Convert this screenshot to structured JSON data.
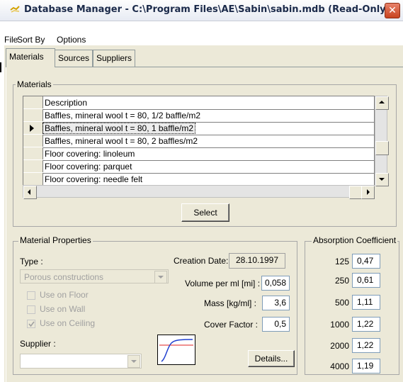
{
  "window": {
    "title": "Database Manager - C:\\Program Files\\AE\\Sabin\\sabin.mdb (Read-Only)",
    "close_label": "✕"
  },
  "menu": [
    {
      "label": "File"
    },
    {
      "label": "Sort By"
    },
    {
      "label": "Options"
    }
  ],
  "tabs": [
    {
      "label": "Materials",
      "active": true
    },
    {
      "label": "Sources",
      "active": false
    },
    {
      "label": "Suppliers",
      "active": false
    }
  ],
  "materials_group": {
    "label": "Materials",
    "column_header": "Description",
    "rows": [
      "Baffles, mineral wool  t = 80,  1/2 baffle/m2",
      "Baffles, mineral wool  t = 80,  1 baffle/m2",
      "Baffles, mineral wool  t = 80,  2 baffles/m2",
      "Floor covering: linoleum",
      "Floor covering: parquet",
      "Floor covering: needle felt"
    ],
    "selected_row_index": 1,
    "select_button": "Select"
  },
  "properties": {
    "label": "Material Properties",
    "type_label": "Type :",
    "type_value": "Porous constructions",
    "creation_date_label": "Creation Date:",
    "creation_date": "28.10.1997",
    "volume_label": "Volume per ml [mi] :",
    "volume_value": "0,058",
    "mass_label": "Mass [kg/ml] :",
    "mass_value": "3,6",
    "cover_label": "Cover Factor :",
    "cover_value": "0,5",
    "use_floor": "Use on Floor",
    "use_wall": "Use on Wall",
    "use_ceiling": "Use on Ceiling",
    "use_floor_checked": false,
    "use_wall_checked": false,
    "use_ceiling_checked": true,
    "supplier_label": "Supplier :",
    "supplier_value": "",
    "details_button": "Details..."
  },
  "absorption": {
    "label": "Absorption Coefficient",
    "rows": [
      {
        "freq": "125",
        "value": "0,47"
      },
      {
        "freq": "250",
        "value": "0,61"
      },
      {
        "freq": "500",
        "value": "1,11"
      },
      {
        "freq": "1000",
        "value": "1,22"
      },
      {
        "freq": "2000",
        "value": "1,22"
      },
      {
        "freq": "4000",
        "value": "1,19"
      }
    ]
  }
}
